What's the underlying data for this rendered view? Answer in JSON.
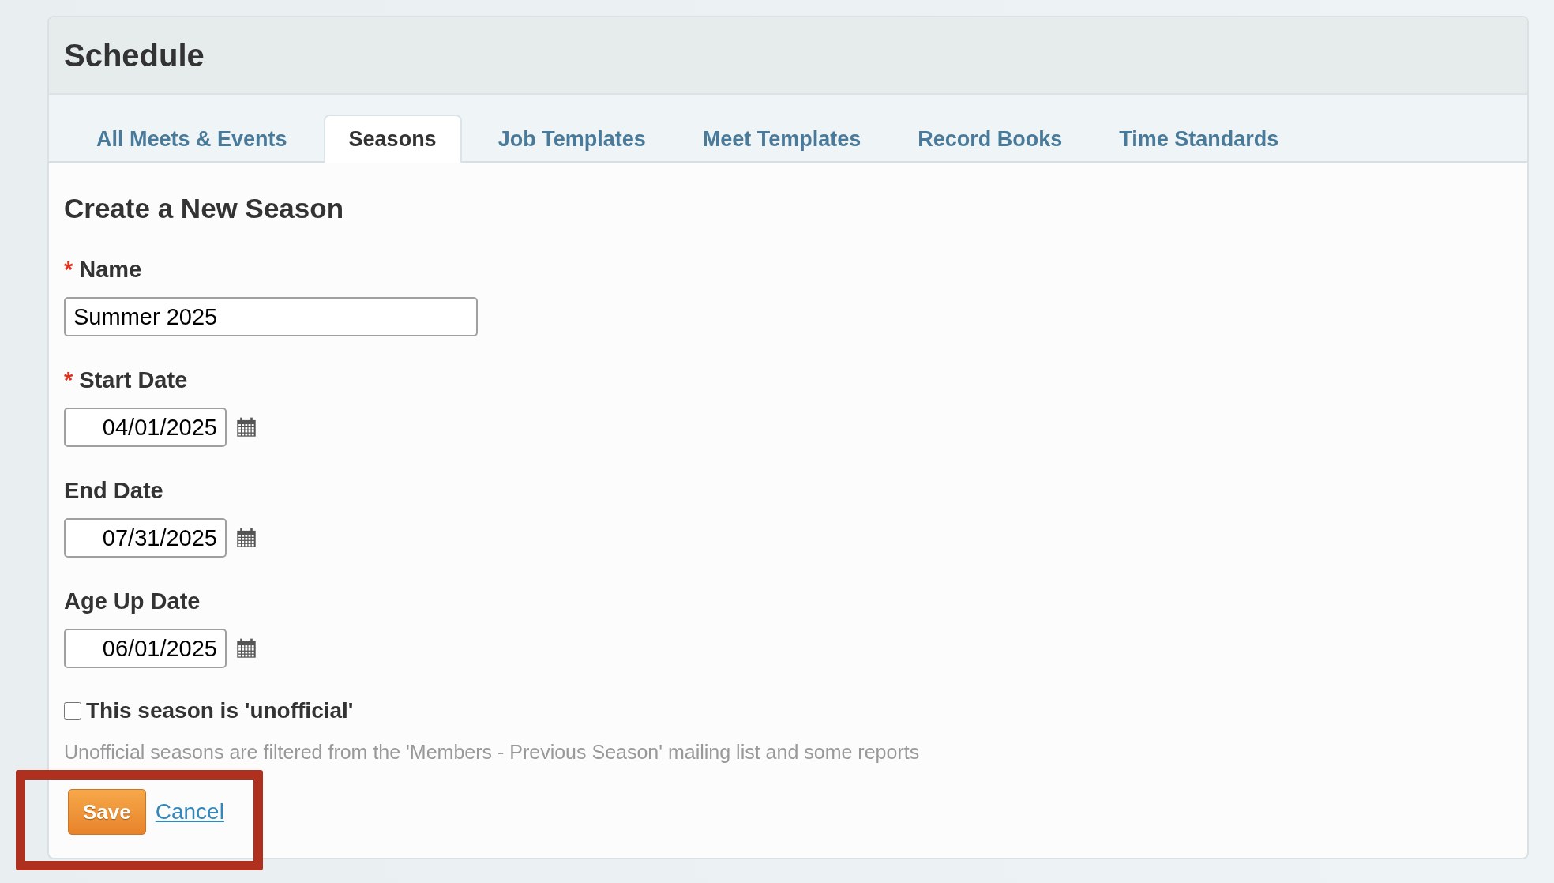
{
  "page": {
    "title": "Schedule"
  },
  "tabs": [
    {
      "label": "All Meets & Events",
      "selected": false
    },
    {
      "label": "Seasons",
      "selected": true
    },
    {
      "label": "Job Templates",
      "selected": false
    },
    {
      "label": "Meet Templates",
      "selected": false
    },
    {
      "label": "Record Books",
      "selected": false
    },
    {
      "label": "Time Standards",
      "selected": false
    }
  ],
  "form": {
    "heading": "Create a New Season",
    "fields": [
      {
        "kind": "text",
        "label": "Name",
        "required_mark": "*",
        "value": "Summer 2025"
      },
      {
        "kind": "date",
        "label": "Start Date",
        "required_mark": "*",
        "value": "04/01/2025"
      },
      {
        "kind": "date",
        "label": "End Date",
        "value": "07/31/2025"
      },
      {
        "kind": "date",
        "label": "Age Up Date",
        "value": "06/01/2025"
      }
    ],
    "unofficial": {
      "label": "This season is 'unofficial'",
      "checked": false,
      "help": "Unofficial seasons are filtered from the 'Members - Previous Season' mailing list and some reports"
    },
    "save_button": "Save",
    "cancel_link": "Cancel"
  }
}
